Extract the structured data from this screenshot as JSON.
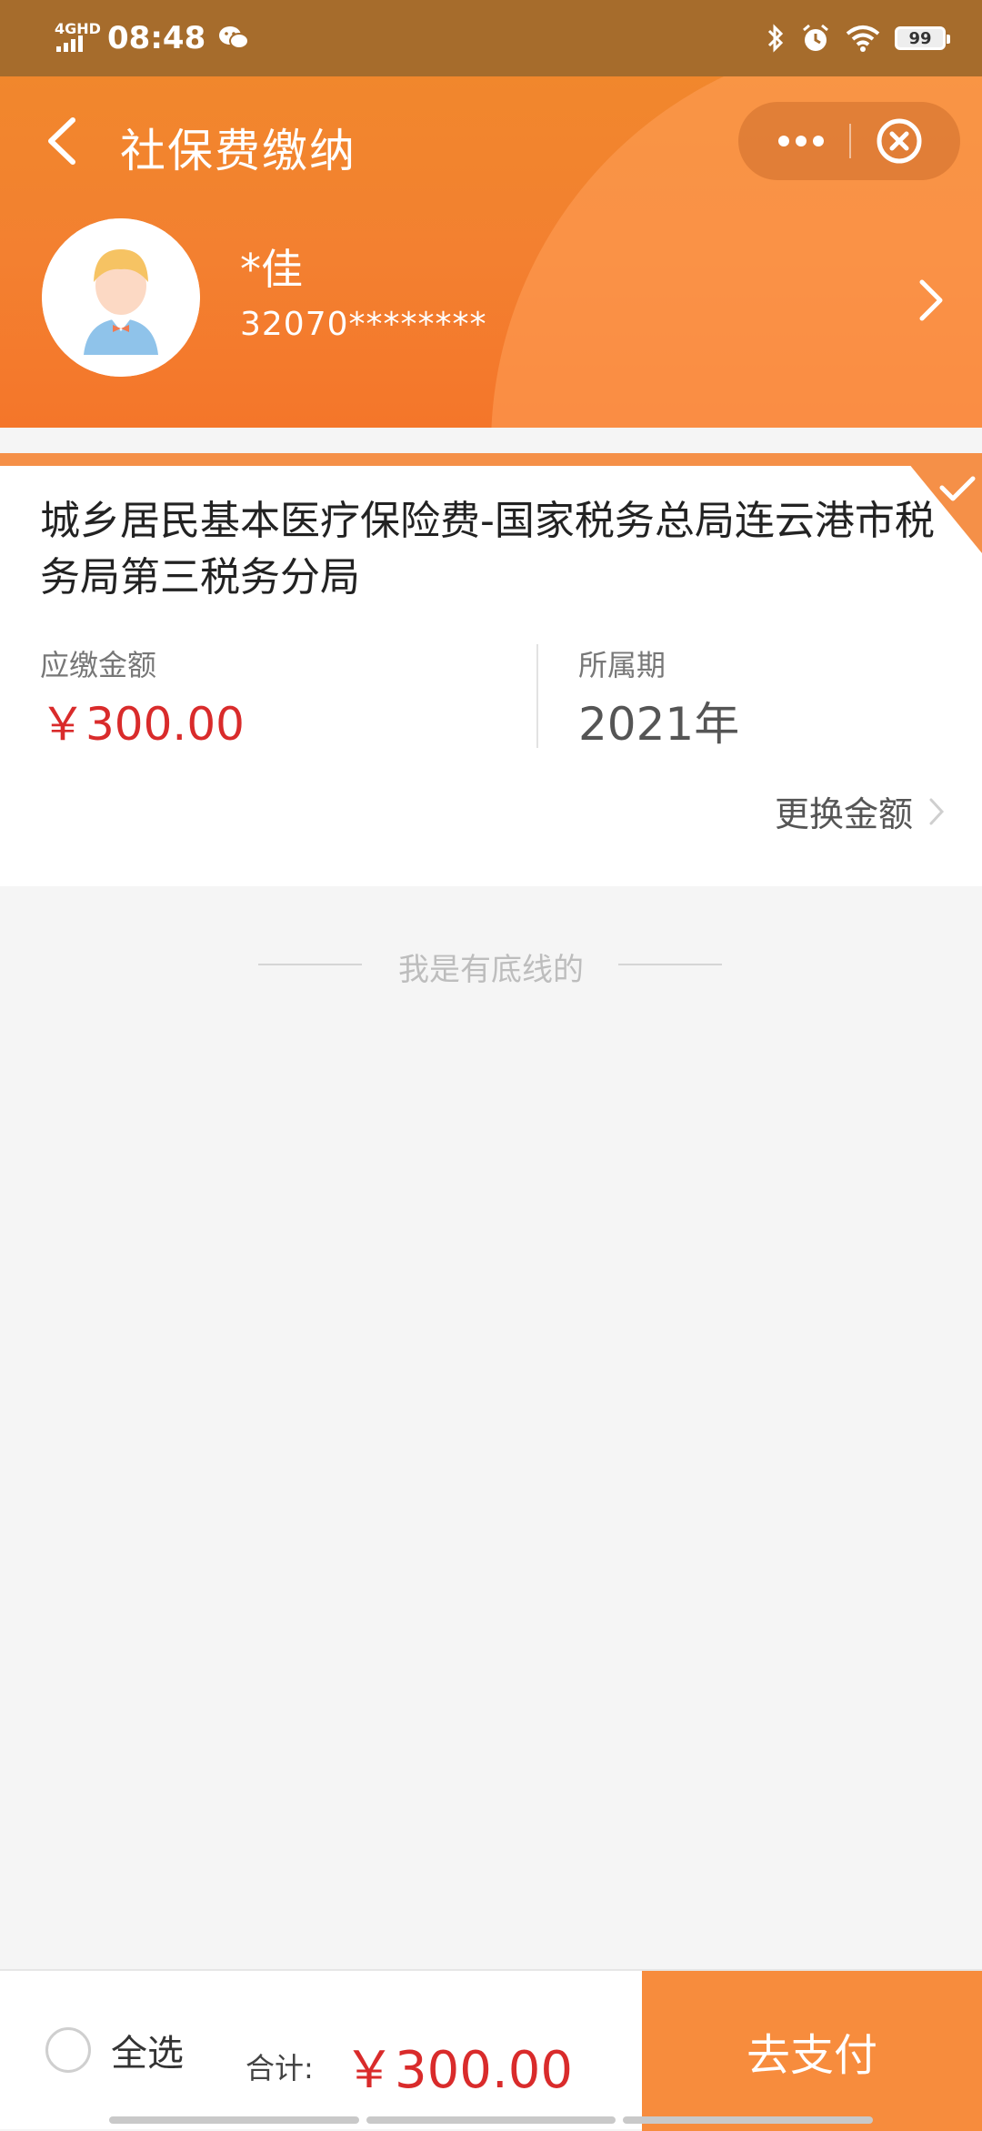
{
  "status_bar": {
    "network": "4GHD",
    "time": "08:48",
    "battery": "99"
  },
  "nav": {
    "title": "社保费缴纳"
  },
  "user": {
    "name": "*佳",
    "id_masked": "32070********"
  },
  "item": {
    "title": "城乡居民基本医疗保险费-国家税务总局连云港市税务局第三税务分局",
    "amount_label": "应缴金额",
    "amount_value": "￥300.00",
    "period_label": "所属期",
    "period_value": "2021年",
    "change_amount": "更换金额",
    "selected": true
  },
  "list_end_text": "我是有底线的",
  "bottom_bar": {
    "select_all": "全选",
    "total_label": "合计:",
    "total_value": "￥300.00",
    "pay_button": "去支付"
  },
  "colors": {
    "brand_orange": "#f38030",
    "price_red": "#d92b2b",
    "pay_button": "#f78c3d"
  },
  "icons": [
    "signal-icon",
    "wechat-icon",
    "bluetooth-icon",
    "alarm-icon",
    "wifi-icon",
    "battery-icon",
    "back-arrow-icon",
    "more-icon",
    "close-circle-icon",
    "avatar-icon",
    "chevron-right-icon",
    "checkmark-icon",
    "radio-unchecked-icon"
  ]
}
